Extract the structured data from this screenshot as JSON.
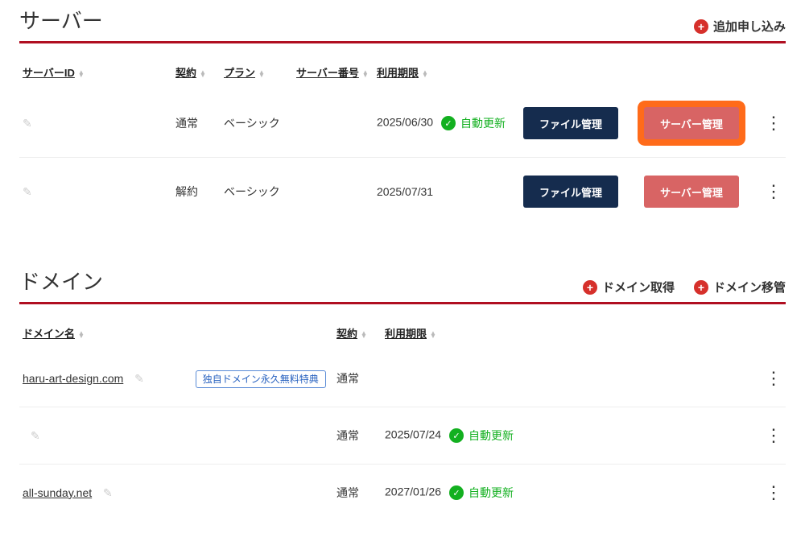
{
  "server_section": {
    "title": "サーバー",
    "add_label": "追加申し込み",
    "headers": {
      "id": "サーバーID",
      "contract": "契約",
      "plan": "プラン",
      "number": "サーバー番号",
      "expiry": "利用期限"
    },
    "rows": [
      {
        "id": "",
        "contract": "通常",
        "plan": "ベーシック",
        "number": "",
        "expiry": "2025/06/30",
        "status": "自動更新",
        "file_btn": "ファイル管理",
        "server_btn": "サーバー管理",
        "highlight": true
      },
      {
        "id": "",
        "contract": "解約",
        "plan": "ベーシック",
        "number": "",
        "expiry": "2025/07/31",
        "status": "",
        "file_btn": "ファイル管理",
        "server_btn": "サーバー管理",
        "highlight": false
      }
    ]
  },
  "domain_section": {
    "title": "ドメイン",
    "get_label": "ドメイン取得",
    "transfer_label": "ドメイン移管",
    "headers": {
      "name": "ドメイン名",
      "contract": "契約",
      "expiry": "利用期限"
    },
    "badge": "独自ドメイン永久無料特典",
    "rows": [
      {
        "name": "haru-art-design.com",
        "show_badge": true,
        "contract": "通常",
        "expiry": "",
        "status": ""
      },
      {
        "name": "",
        "show_badge": false,
        "contract": "通常",
        "expiry": "2025/07/24",
        "status": "自動更新"
      },
      {
        "name": "all-sunday.net",
        "show_badge": false,
        "contract": "通常",
        "expiry": "2027/01/26",
        "status": "自動更新"
      }
    ]
  }
}
